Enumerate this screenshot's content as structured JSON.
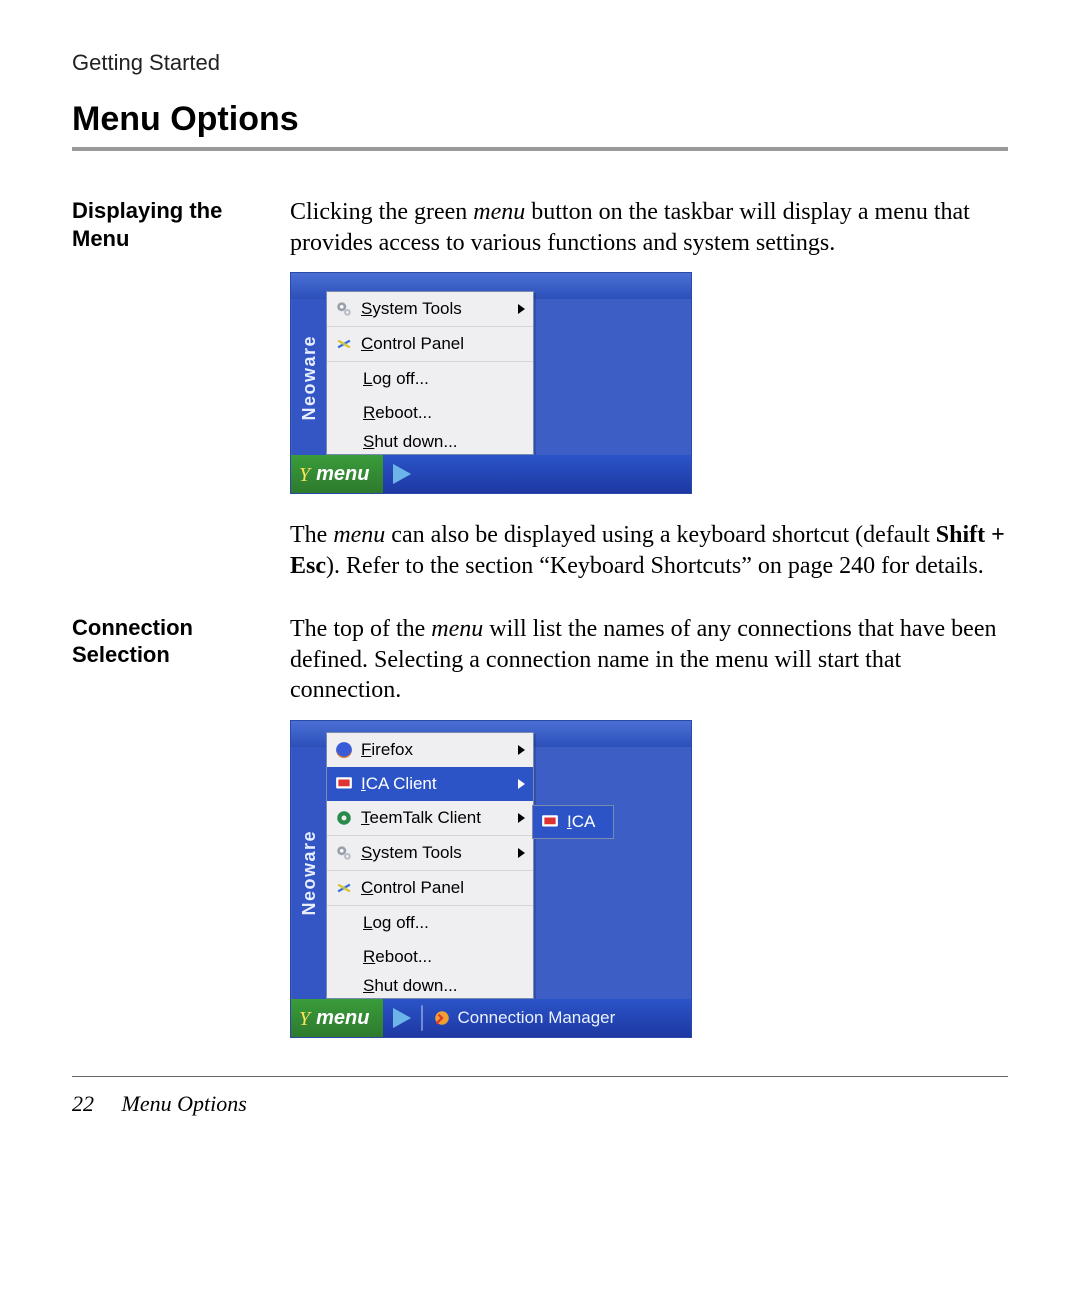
{
  "header": {
    "running": "Getting Started",
    "h1": "Menu Options"
  },
  "section1": {
    "side": "Displaying the Menu",
    "para1_pre": "Clicking the green ",
    "para1_em": "menu",
    "para1_post": " button on the taskbar will display a menu that provides access to various functions and system settings.",
    "para2_pre": "The ",
    "para2_em": "menu",
    "para2_mid": " can also be displayed using a keyboard shortcut (default ",
    "para2_bold": "Shift + Esc",
    "para2_post": "). Refer to the section “Keyboard Shortcuts” on page 240 for details."
  },
  "section2": {
    "side": "Connection Selection",
    "para1_pre": "The top of the ",
    "para1_em": "menu",
    "para1_post": " will list the names of any connections that have been defined. Selecting a connection name in the menu will start that connection."
  },
  "fig1": {
    "brand": "Neoware",
    "menu_button": "menu",
    "items": {
      "system_tools": "System Tools",
      "control_panel": "Control Panel",
      "log_off": "Log off...",
      "reboot": "Reboot...",
      "shut_down": "Shut down..."
    }
  },
  "fig2": {
    "brand": "Neoware",
    "menu_button": "menu",
    "items": {
      "firefox": "Firefox",
      "ica_client": "ICA Client",
      "teemtalk": "TeemTalk Client",
      "system_tools": "System Tools",
      "control_panel": "Control Panel",
      "log_off": "Log off...",
      "reboot": "Reboot...",
      "shut_down": "Shut down..."
    },
    "submenu": {
      "ica": "ICA"
    },
    "taskbar": {
      "connection_manager": "Connection Manager"
    }
  },
  "footer": {
    "page_number": "22",
    "title": "Menu Options"
  }
}
